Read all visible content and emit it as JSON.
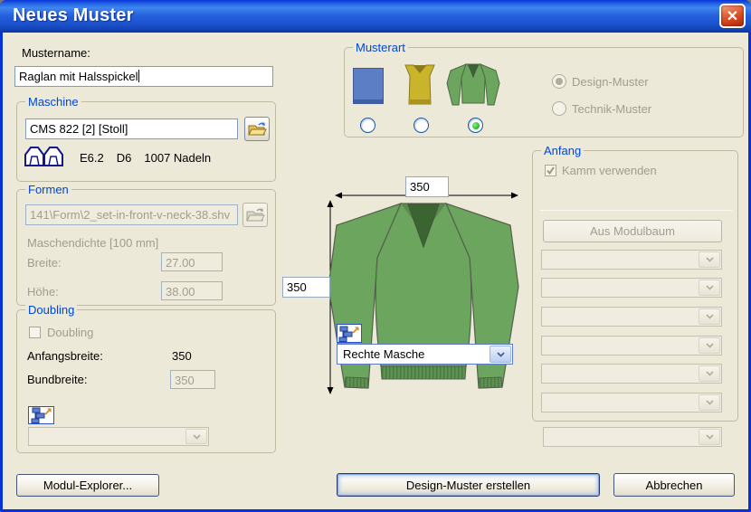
{
  "window": {
    "title": "Neues Muster"
  },
  "icons": {
    "close_glyph": "✕"
  },
  "colors": {
    "dialog_bg": "#ECE9D8",
    "titlebar_blue": "#2560DB",
    "group_label_blue": "#0046D5",
    "sweater_green": "#6BA55E",
    "neck_dark_green": "#3A6531",
    "vest_gold": "#C9B42C",
    "swatch_blue": "#5B7EC5",
    "close_red": "#D94C25"
  },
  "mustername": {
    "label": "Mustername:",
    "value": "Raglan mit Halsspickel"
  },
  "maschine": {
    "title": "Maschine",
    "machine_name": "CMS 822 [2] [Stoll]",
    "gauge": "E6.2",
    "system": "D6",
    "needles": "1007 Nadeln"
  },
  "formen": {
    "title": "Formen",
    "shape_path": "141\\Form\\2_set-in-front-v-neck-38.shv",
    "density_label": "Maschendichte [100 mm]",
    "width_label": "Breite:",
    "width_value": "27.00",
    "height_label": "Höhe:",
    "height_value": "38.00"
  },
  "doubling": {
    "title": "Doubling",
    "checkbox_label": "Doubling",
    "start_width_label": "Anfangsbreite:",
    "start_width_value": "350",
    "cuff_width_label": "Bundbreite:",
    "cuff_width_value": "350"
  },
  "musterart": {
    "title": "Musterart",
    "design_label": "Design-Muster",
    "technik_label": "Technik-Muster"
  },
  "anfang": {
    "title": "Anfang",
    "comb_checkbox_label": "Kamm verwenden",
    "module_tree_button_label": "Aus Modulbaum"
  },
  "preview": {
    "width_value": "350",
    "height_value": "350",
    "base_stitch": "Rechte Masche"
  },
  "footer": {
    "modul_explorer_label": "Modul-Explorer...",
    "create_label": "Design-Muster erstellen",
    "cancel_label": "Abbrechen"
  }
}
